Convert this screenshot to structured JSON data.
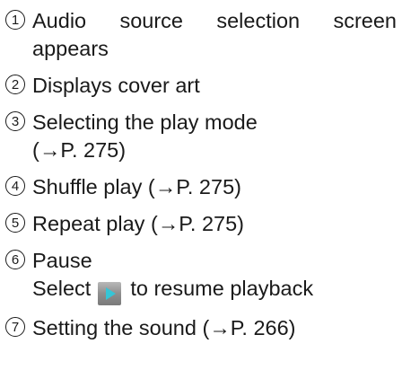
{
  "items": [
    {
      "number": "1",
      "line1_words": [
        "Audio",
        "source",
        "selection",
        "screen"
      ],
      "line2": "appears"
    },
    {
      "number": "2",
      "line1": "Displays cover art"
    },
    {
      "number": "3",
      "line1": "Selecting the play mode",
      "line2": "(→P. 275)"
    },
    {
      "number": "4",
      "line1": "Shuffle play (→P. 275)"
    },
    {
      "number": "5",
      "line1": "Repeat play (→P. 275)"
    },
    {
      "number": "6",
      "line1": "Pause",
      "line2_before": "Select",
      "line2_icon": "play-icon",
      "line2_after": "to resume playback"
    },
    {
      "number": "7",
      "line1": "Setting the sound (→P. 266)"
    }
  ]
}
